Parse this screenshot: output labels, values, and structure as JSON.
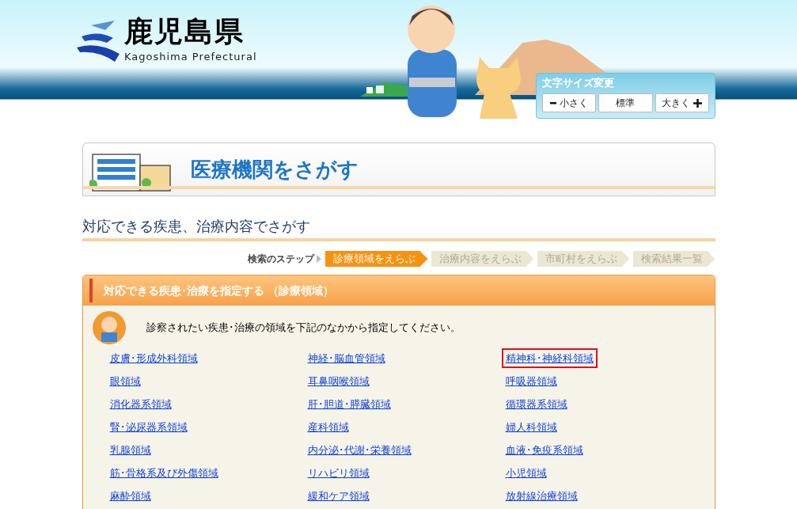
{
  "header": {
    "logo_title": "鹿児島県",
    "logo_subtitle": "Kagoshima Prefectural",
    "font_size": {
      "label": "文字サイズ変更",
      "buttons": [
        {
          "kind": "smaller",
          "label": "小さく"
        },
        {
          "kind": "normal",
          "label": "標準"
        },
        {
          "kind": "larger",
          "label": "大きく"
        }
      ]
    }
  },
  "banner": {
    "title": "医療機関をさがす"
  },
  "section_title": "対応できる疾患、治療内容でさがす",
  "steps": {
    "label": "検索のステップ",
    "items": [
      {
        "label": "診療領域をえらぶ",
        "selected": true
      },
      {
        "label": "治療内容をえらぶ",
        "selected": false
      },
      {
        "label": "市町村をえらぶ",
        "selected": false
      },
      {
        "label": "検索結果一覧",
        "selected": false
      }
    ]
  },
  "panel": {
    "title": "対応できる疾患･治療を指定する （診療領域）",
    "instruction": "診察されたい疾患･治療の領域を下記のなかから指定してください。",
    "links": [
      {
        "label": "皮膚･形成外科領域",
        "selected": false
      },
      {
        "label": "神経･脳血管領域",
        "selected": false
      },
      {
        "label": "精神科･神経科領域",
        "selected": true
      },
      {
        "label": "眼領域",
        "selected": false
      },
      {
        "label": "耳鼻咽喉領域",
        "selected": false
      },
      {
        "label": "呼吸器領域",
        "selected": false
      },
      {
        "label": "消化器系領域",
        "selected": false
      },
      {
        "label": "肝･胆道･膵臓領域",
        "selected": false
      },
      {
        "label": "循環器系領域",
        "selected": false
      },
      {
        "label": "腎･泌尿器系領域",
        "selected": false
      },
      {
        "label": "産科領域",
        "selected": false
      },
      {
        "label": "婦人科領域",
        "selected": false
      },
      {
        "label": "乳腺領域",
        "selected": false
      },
      {
        "label": "内分泌･代謝･栄養領域",
        "selected": false
      },
      {
        "label": "血液･免疫系領域",
        "selected": false
      },
      {
        "label": "筋･骨格系及び外傷領域",
        "selected": false
      },
      {
        "label": "リハビリ領域",
        "selected": false
      },
      {
        "label": "小児領域",
        "selected": false
      },
      {
        "label": "麻酔領域",
        "selected": false
      },
      {
        "label": "緩和ケア領域",
        "selected": false
      },
      {
        "label": "放射線治療領域",
        "selected": false
      }
    ]
  }
}
